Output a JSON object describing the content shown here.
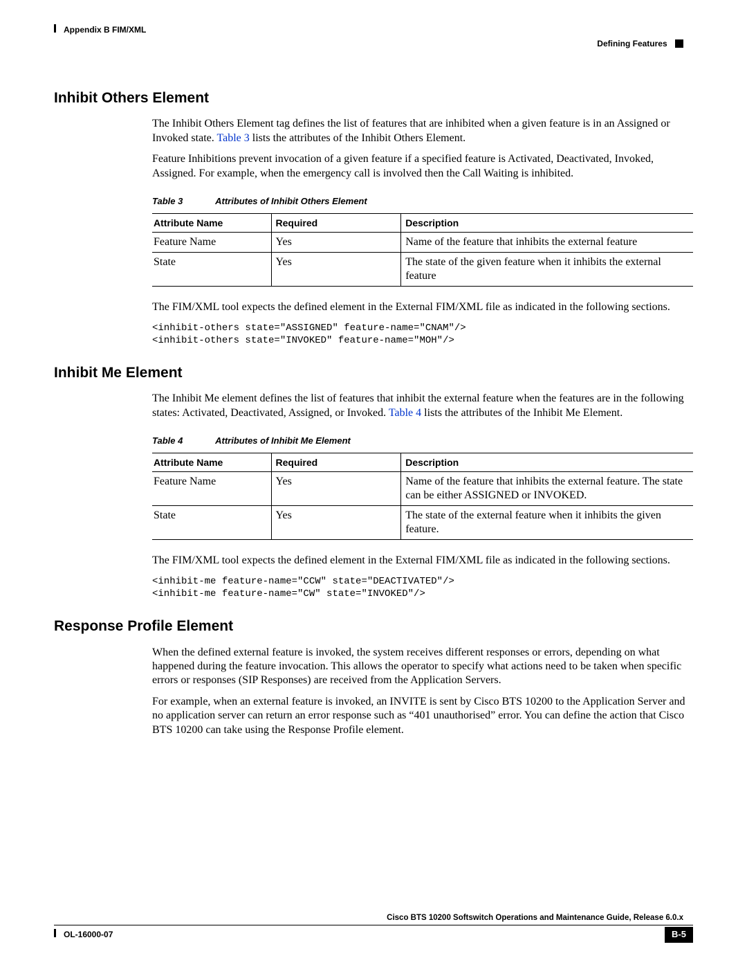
{
  "header": {
    "left": "Appendix B      FIM/XML",
    "right": "Defining Features"
  },
  "sections": {
    "s1": {
      "title": "Inhibit Others Element",
      "p1a": "The Inhibit Others Element tag defines the list of features that are inhibited when a given feature is in an Assigned or Invoked state. ",
      "p1link": "Table 3",
      "p1b": " lists the attributes of the Inhibit Others Element.",
      "p2": "Feature Inhibitions prevent invocation of a given feature if a specified feature is Activated, Deactivated, Invoked, Assigned. For example, when the emergency call is involved then the Call Waiting is inhibited.",
      "table_caption_label": "Table 3",
      "table_caption_title": "Attributes of Inhibit Others Element",
      "th1": "Attribute Name",
      "th2": "Required",
      "th3": "Description",
      "r1c1": "Feature Name",
      "r1c2": "Yes",
      "r1c3": "Name of the feature that inhibits the external feature",
      "r2c1": "State",
      "r2c2": "Yes",
      "r2c3": "The state of the given feature when it inhibits the external feature",
      "p3": "The FIM/XML tool expects the defined element in the External FIM/XML file as indicated in the following sections.",
      "code": "<inhibit-others state=\"ASSIGNED\" feature-name=\"CNAM\"/>\n<inhibit-others state=\"INVOKED\" feature-name=\"MOH\"/>"
    },
    "s2": {
      "title": "Inhibit Me Element",
      "p1a": "The Inhibit Me element defines the list of features that inhibit the external feature when the features are in the following states: Activated, Deactivated, Assigned, or Invoked. ",
      "p1link": "Table 4",
      "p1b": " lists the attributes of the Inhibit Me Element.",
      "table_caption_label": "Table 4",
      "table_caption_title": "Attributes of Inhibit Me Element",
      "th1": "Attribute Name",
      "th2": "Required",
      "th3": "Description",
      "r1c1": "Feature Name",
      "r1c2": "Yes",
      "r1c3": "Name of the feature that inhibits the external feature. The state can be either ASSIGNED or INVOKED.",
      "r2c1": "State",
      "r2c2": "Yes",
      "r2c3": "The state of the external feature when it inhibits the given feature.",
      "p3": "The FIM/XML tool expects the defined element in the External FIM/XML file as indicated in the following sections.",
      "code": "<inhibit-me feature-name=\"CCW\" state=\"DEACTIVATED\"/>\n<inhibit-me feature-name=\"CW\" state=\"INVOKED\"/>"
    },
    "s3": {
      "title": "Response Profile Element",
      "p1": "When the defined external feature is invoked, the system receives different responses or errors, depending on what happened during the feature invocation. This allows the operator to specify what actions need to be taken when specific errors or responses (SIP Responses) are received from the Application Servers.",
      "p2": "For example, when an external feature is invoked, an INVITE is sent by Cisco BTS 10200 to the Application Server and no application server can return an error response such as “401 unauthorised” error. You can define the action that Cisco BTS 10200 can take using the Response Profile element."
    }
  },
  "footer": {
    "title": "Cisco BTS 10200 Softswitch Operations and Maintenance Guide, Release 6.0.x",
    "left": "OL-16000-07",
    "pagenum": "B-5"
  }
}
